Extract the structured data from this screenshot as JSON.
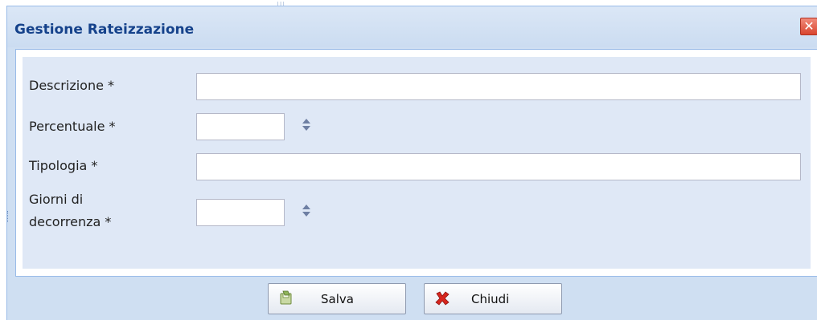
{
  "window": {
    "title": "Gestione Rateizzazione",
    "close_glyph": "✕",
    "close_icon": "close-icon"
  },
  "form": {
    "descrizione": {
      "label": "Descrizione *",
      "value": ""
    },
    "percentuale": {
      "label": "Percentuale *",
      "value": ""
    },
    "tipologia": {
      "label": "Tipologia *",
      "value": ""
    },
    "giorni_decorrenza": {
      "label_line1": "Giorni di",
      "label_line2": "decorrenza *",
      "value": ""
    }
  },
  "buttons": {
    "salva": {
      "label": "Salva",
      "icon": "save-icon"
    },
    "chiudi": {
      "label": "Chiudi",
      "icon": "cancel-icon"
    }
  },
  "colors": {
    "title": "#15428b",
    "panel": "#dfe8f6",
    "frame": "#cfdff2",
    "border": "#99bbe8",
    "close": "#d9452f",
    "cancel_icon": "#d7261e"
  }
}
